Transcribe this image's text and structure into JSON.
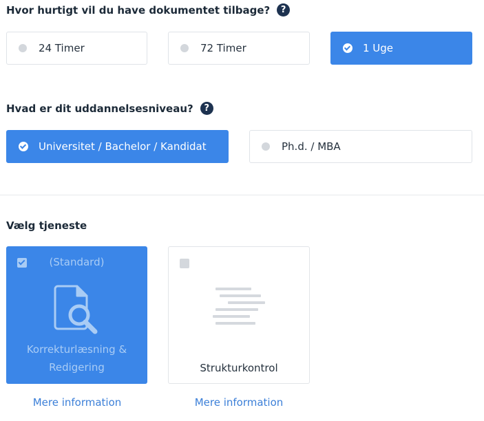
{
  "turnaround": {
    "question": "Hvor hurtigt vil du have dokumentet tilbage?",
    "help": "?",
    "options": [
      {
        "label": "24 Timer",
        "selected": false
      },
      {
        "label": "72 Timer",
        "selected": false
      },
      {
        "label": "1 Uge",
        "selected": true
      }
    ]
  },
  "education": {
    "question": "Hvad er dit uddannelsesniveau?",
    "help": "?",
    "options": [
      {
        "label": "Universitet / Bachelor / Kandidat",
        "selected": true
      },
      {
        "label": "Ph.d. / MBA",
        "selected": false
      }
    ]
  },
  "service": {
    "heading": "Vælg tjeneste",
    "cards": [
      {
        "tag": "(Standard)",
        "name": "Korrekturlæsning & Redigering",
        "icon": "document-search-icon",
        "selected": true,
        "more": "Mere information"
      },
      {
        "tag": "",
        "name": "Strukturkontrol",
        "icon": "text-lines-icon",
        "selected": false,
        "more": "Mere information"
      }
    ]
  },
  "colors": {
    "accent": "#3b86e8",
    "heading": "#1c2a38",
    "link": "#3b7fd8"
  }
}
